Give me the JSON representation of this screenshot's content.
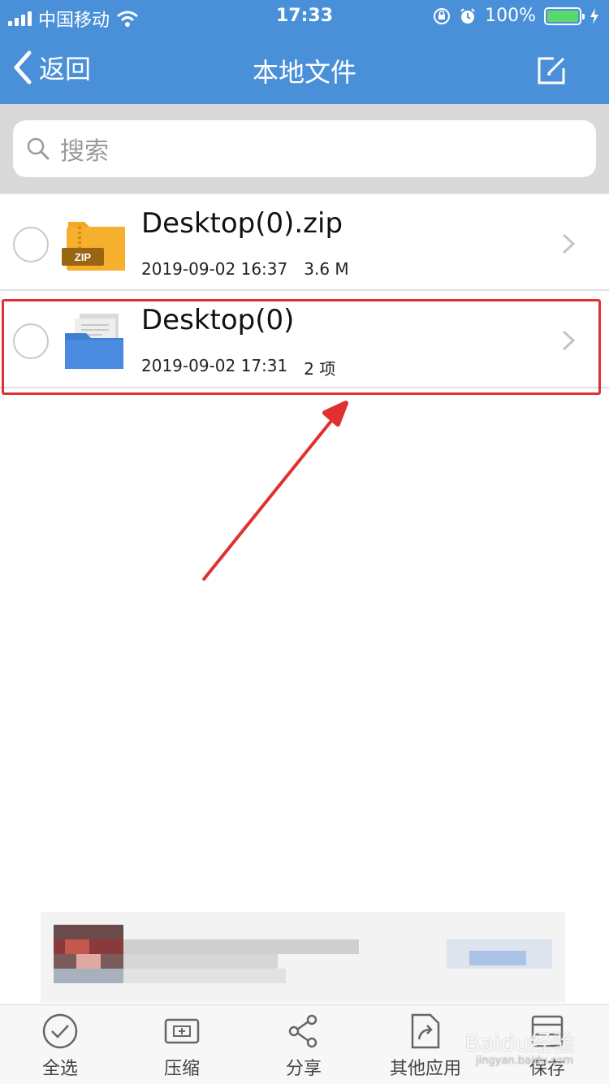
{
  "status_bar": {
    "carrier": "中国移动",
    "time": "17:33",
    "battery": "100%",
    "battery_level": 1.0
  },
  "nav": {
    "back_label": "返回",
    "title": "本地文件"
  },
  "search": {
    "placeholder": "搜索"
  },
  "files": [
    {
      "name": "Desktop(0).zip",
      "date": "2019-09-02 16:37",
      "info": "3.6 M",
      "icon": "zip-file-icon",
      "badge": "ZIP"
    },
    {
      "name": "Desktop(0)",
      "date": "2019-09-02 17:31",
      "info": "2 项",
      "icon": "folder-icon"
    }
  ],
  "toolbar": {
    "select_all": "全选",
    "compress": "压缩",
    "share": "分享",
    "other_apps": "其他应用",
    "save": "保存"
  },
  "watermark": {
    "brand": "Baidu经验",
    "url": "jingyan.baidu.com"
  },
  "colors": {
    "nav_bg": "#4a90d9",
    "highlight": "#e03030",
    "zip_icon": "#f5a623",
    "folder_icon": "#3d7fd1"
  }
}
